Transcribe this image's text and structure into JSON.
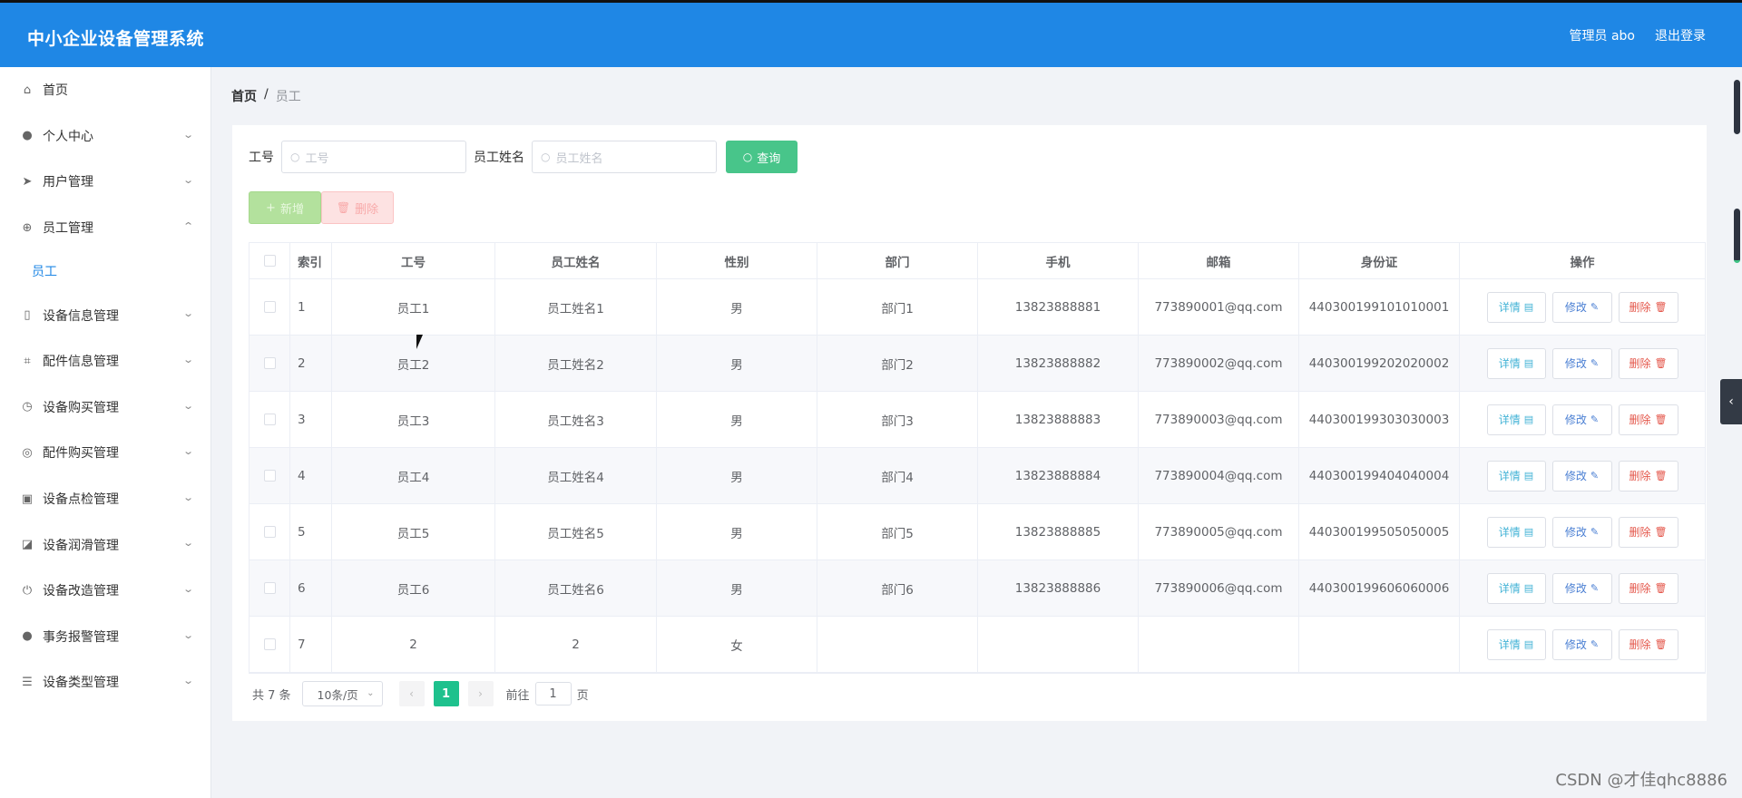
{
  "header": {
    "title": "中小企业设备管理系统",
    "user_label": "管理员 abo",
    "logout_label": "退出登录",
    "background": "#1f87e5"
  },
  "sidebar": {
    "items": [
      {
        "label": "首页",
        "icon": "home-icon"
      },
      {
        "label": "个人中心",
        "icon": "user-icon"
      },
      {
        "label": "用户管理",
        "icon": "send-icon"
      },
      {
        "label": "员工管理",
        "icon": "compass-icon"
      },
      {
        "label": "设备信息管理",
        "icon": "phone-icon"
      },
      {
        "label": "配件信息管理",
        "icon": "crop-icon"
      },
      {
        "label": "设备购买管理",
        "icon": "clock-icon"
      },
      {
        "label": "配件购买管理",
        "icon": "target-icon"
      },
      {
        "label": "设备点检管理",
        "icon": "clipboard-icon"
      },
      {
        "label": "设备润滑管理",
        "icon": "chart-icon"
      },
      {
        "label": "设备改造管理",
        "icon": "power-icon"
      },
      {
        "label": "事务报警管理",
        "icon": "user-icon"
      },
      {
        "label": "设备类型管理",
        "icon": "list-icon"
      }
    ],
    "submenu_employee": "员工"
  },
  "breadcrumb": {
    "home": "首页",
    "sep": "/",
    "current": "员工"
  },
  "search": {
    "emp_no_label": "工号",
    "emp_no_placeholder": "工号",
    "emp_name_label": "员工姓名",
    "emp_name_placeholder": "员工姓名",
    "query_label": "查询"
  },
  "actions": {
    "add_label": "新增",
    "delete_label": "删除"
  },
  "table": {
    "headers": [
      "索引",
      "工号",
      "员工姓名",
      "性别",
      "部门",
      "手机",
      "邮箱",
      "身份证",
      "操作"
    ],
    "rows": [
      {
        "idx": "1",
        "no": "员工1",
        "name": "员工姓名1",
        "sex": "男",
        "dept": "部门1",
        "phone": "13823888881",
        "mail": "773890001@qq.com",
        "id": "440300199101010001"
      },
      {
        "idx": "2",
        "no": "员工2",
        "name": "员工姓名2",
        "sex": "男",
        "dept": "部门2",
        "phone": "13823888882",
        "mail": "773890002@qq.com",
        "id": "440300199202020002"
      },
      {
        "idx": "3",
        "no": "员工3",
        "name": "员工姓名3",
        "sex": "男",
        "dept": "部门3",
        "phone": "13823888883",
        "mail": "773890003@qq.com",
        "id": "440300199303030003"
      },
      {
        "idx": "4",
        "no": "员工4",
        "name": "员工姓名4",
        "sex": "男",
        "dept": "部门4",
        "phone": "13823888884",
        "mail": "773890004@qq.com",
        "id": "440300199404040004"
      },
      {
        "idx": "5",
        "no": "员工5",
        "name": "员工姓名5",
        "sex": "男",
        "dept": "部门5",
        "phone": "13823888885",
        "mail": "773890005@qq.com",
        "id": "440300199505050005"
      },
      {
        "idx": "6",
        "no": "员工6",
        "name": "员工姓名6",
        "sex": "男",
        "dept": "部门6",
        "phone": "13823888886",
        "mail": "773890006@qq.com",
        "id": "440300199606060006"
      },
      {
        "idx": "7",
        "no": "2",
        "name": "2",
        "sex": "女",
        "dept": "",
        "phone": "",
        "mail": "",
        "id": ""
      }
    ],
    "op_detail": "详情",
    "op_edit": "修改",
    "op_delete": "删除"
  },
  "pagination": {
    "total": "共 7 条",
    "page_size": "10条/页",
    "current_page": "1",
    "goto_label": "前往",
    "goto_value": "1",
    "page_unit": "页"
  },
  "watermark": "CSDN @才佳qhc8886"
}
